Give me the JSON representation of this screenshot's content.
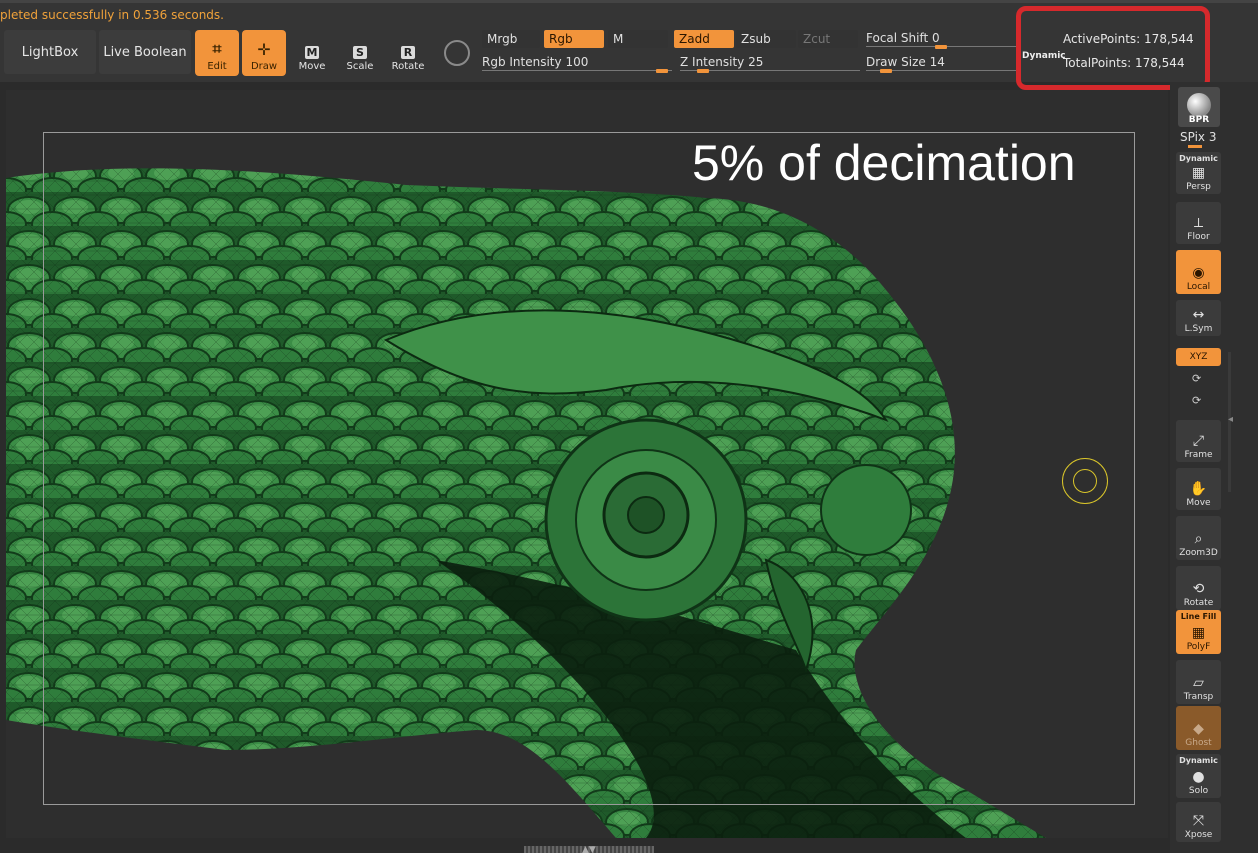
{
  "status": {
    "message": "pleted successfully in 0.536 seconds."
  },
  "toolbar": {
    "lightbox": "LightBox",
    "live_boolean": "Live Boolean",
    "tools": [
      {
        "name": "edit",
        "label": "Edit",
        "glyph": "⌗",
        "active": true
      },
      {
        "name": "draw",
        "label": "Draw",
        "glyph": "✛",
        "active": true
      },
      {
        "name": "move",
        "label": "Move",
        "glyph": "M",
        "active": false
      },
      {
        "name": "scale",
        "label": "Scale",
        "glyph": "S",
        "active": false
      },
      {
        "name": "rotate",
        "label": "Rotate",
        "glyph": "R",
        "active": false
      }
    ],
    "modes": {
      "mrgb": "Mrgb",
      "rgb": "Rgb",
      "m": "M",
      "zadd": "Zadd",
      "zsub": "Zsub",
      "zcut": "Zcut"
    },
    "rgb_intensity": {
      "label": "Rgb Intensity",
      "value": "100",
      "fraction": 1.0
    },
    "z_intensity": {
      "label": "Z Intensity",
      "value": "25",
      "fraction": 0.25
    },
    "focal_shift": {
      "label": "Focal Shift",
      "value": "0",
      "fraction": 0.5
    },
    "draw_size": {
      "label": "Draw Size",
      "value": "14",
      "fraction": 0.1
    },
    "dynamic": "Dynamic"
  },
  "points": {
    "active_label": "ActivePoints:",
    "active_value": "178,544",
    "total_label": "TotalPoints:",
    "total_value": "178,544"
  },
  "canvas": {
    "annotation": "5% of decimation",
    "model": "green owl sculpt with wireframe"
  },
  "shelf": {
    "bpr": "BPR",
    "spix_label": "SPix",
    "spix_value": "3",
    "items": [
      {
        "name": "persp",
        "top": "Dynamic",
        "label": "Persp",
        "state": "normal"
      },
      {
        "name": "floor",
        "top": "",
        "label": "Floor",
        "state": "normal"
      },
      {
        "name": "local",
        "top": "",
        "label": "Local",
        "state": "on"
      },
      {
        "name": "lsym",
        "top": "",
        "label": "L.Sym",
        "state": "normal"
      },
      {
        "name": "xyz",
        "top": "",
        "label": "XYZ",
        "state": "on"
      },
      {
        "name": "frame",
        "top": "",
        "label": "Frame",
        "state": "normal"
      },
      {
        "name": "move",
        "top": "",
        "label": "Move",
        "state": "normal"
      },
      {
        "name": "zoom3d",
        "top": "",
        "label": "Zoom3D",
        "state": "normal"
      },
      {
        "name": "rotate",
        "top": "",
        "label": "Rotate",
        "state": "normal"
      },
      {
        "name": "polyf",
        "top": "Line Fill",
        "label": "PolyF",
        "state": "on"
      },
      {
        "name": "transp",
        "top": "",
        "label": "Transp",
        "state": "normal"
      },
      {
        "name": "ghost",
        "top": "",
        "label": "Ghost",
        "state": "muted"
      },
      {
        "name": "solo",
        "top": "Dynamic",
        "label": "Solo",
        "state": "normal"
      },
      {
        "name": "xpose",
        "top": "",
        "label": "Xpose",
        "state": "normal"
      }
    ]
  },
  "colors": {
    "accent": "#f2943b",
    "highlight_box": "#d6292c",
    "model_green": "#2f7d3c"
  }
}
